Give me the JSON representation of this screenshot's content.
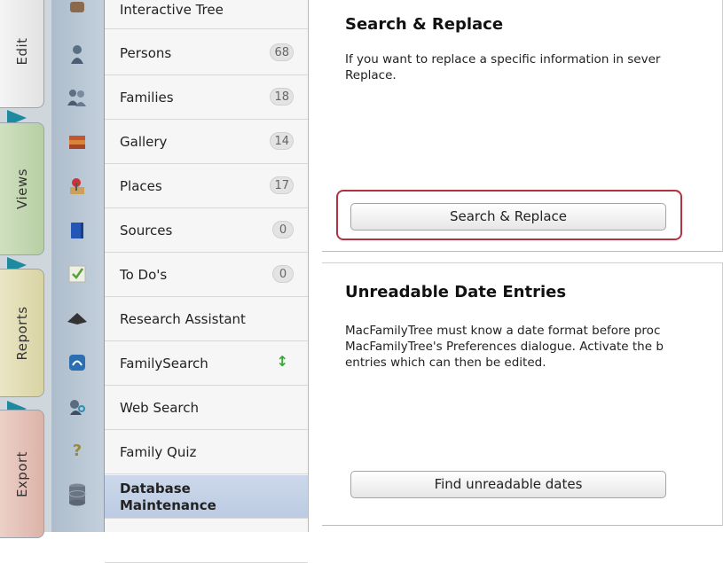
{
  "tabs": [
    {
      "label": "Edit"
    },
    {
      "label": "Views"
    },
    {
      "label": "Reports"
    },
    {
      "label": "Export"
    }
  ],
  "sidebar": {
    "items": [
      {
        "label": "Interactive Tree",
        "count": ""
      },
      {
        "label": "Persons",
        "count": "68"
      },
      {
        "label": "Families",
        "count": "18"
      },
      {
        "label": "Gallery",
        "count": "14"
      },
      {
        "label": "Places",
        "count": "17"
      },
      {
        "label": "Sources",
        "count": "0"
      },
      {
        "label": "To Do's",
        "count": "0"
      },
      {
        "label": "Research Assistant",
        "count": ""
      },
      {
        "label": "FamilySearch",
        "count": ""
      },
      {
        "label": "Web Search",
        "count": ""
      },
      {
        "label": "Family Quiz",
        "count": ""
      },
      {
        "label": "Database\nMaintenance",
        "count": ""
      }
    ]
  },
  "panels": {
    "search_replace": {
      "title": "Search & Replace",
      "description": "If you want to replace a specific information in sever\nReplace.",
      "button": "Search & Replace"
    },
    "unreadable_dates": {
      "title": "Unreadable Date Entries",
      "description": "MacFamilyTree must know a date format before proc\nMacFamilyTree's Preferences dialogue. Activate the b\nentries which can then be edited.",
      "button": "Find unreadable dates"
    }
  },
  "colors": {
    "highlight": "#b3323f",
    "tab_arrow": "#1e8aa0",
    "selected_row": "#c4d2e7"
  }
}
